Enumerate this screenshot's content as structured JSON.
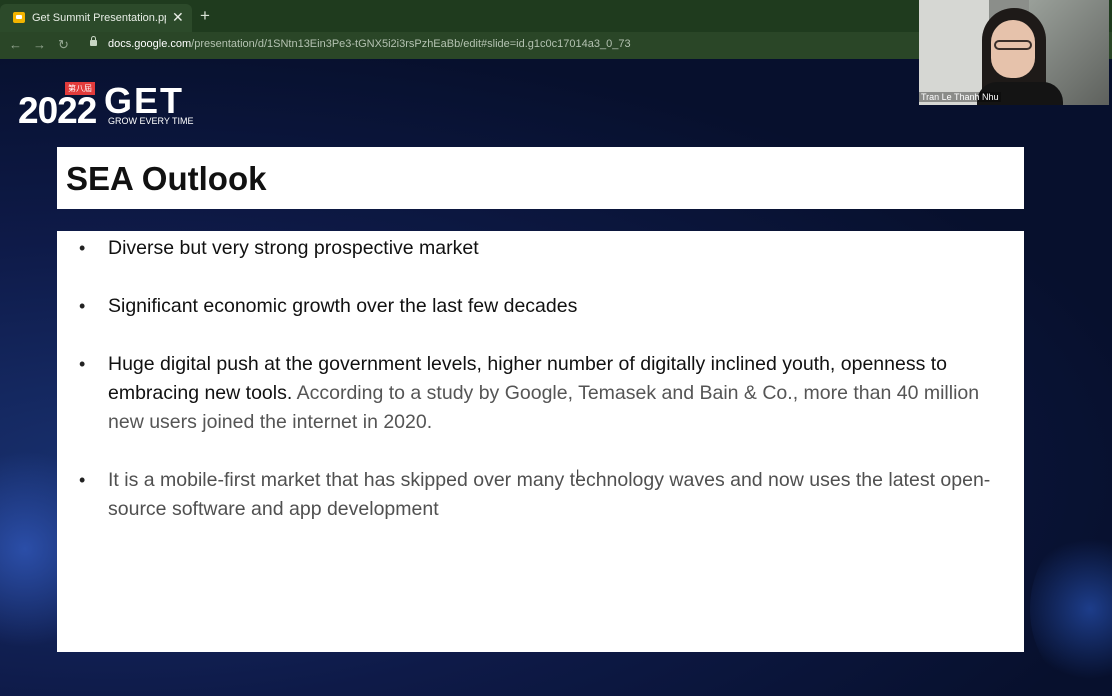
{
  "browser": {
    "tab_title": "Get Summit Presentation.pptx",
    "tab_close": "✕",
    "new_tab": "+",
    "back": "←",
    "forward": "→",
    "reload": "↻",
    "url_host": "docs.google.com",
    "url_path": "/presentation/d/1SNtn13Ein3Pe3-tGNX5i2i3rsPzhEaBb/edit#slide=id.g1c0c17014a3_0_73"
  },
  "logo": {
    "year": "2022",
    "name": "GET",
    "edition": "第八屆",
    "tagline": "GROW EVERY TIME"
  },
  "slide": {
    "title": "SEA Outlook",
    "bullets": [
      {
        "text": "Diverse but very strong prospective market"
      },
      {
        "text": "Significant economic growth over the last few decades"
      },
      {
        "text": "Huge digital push at the government levels, higher number of digitally inclined youth, openness to embracing new tools.",
        "muted": " According to a study by Google, Temasek and Bain & Co., more than 40 million new users joined the internet in 2020."
      },
      {
        "text": "It is a mobile-first market that has skipped over many technology waves and now uses the latest open-source software and app development"
      }
    ],
    "bullet_symbol": "•"
  },
  "webcam": {
    "participant_name": "Tran Le Thanh Nhu"
  },
  "colors": {
    "tab_bar": "#1f3b1e",
    "address_bar": "#2a4627",
    "slide_background": "#0e1a48",
    "slide_box": "#ffffff",
    "logo_accent": "#e23b3b"
  },
  "icons": [
    "docs-slides-favicon",
    "close-icon",
    "plus-icon",
    "back-arrow-icon",
    "forward-arrow-icon",
    "reload-icon",
    "lock-icon",
    "text-cursor-icon"
  ]
}
